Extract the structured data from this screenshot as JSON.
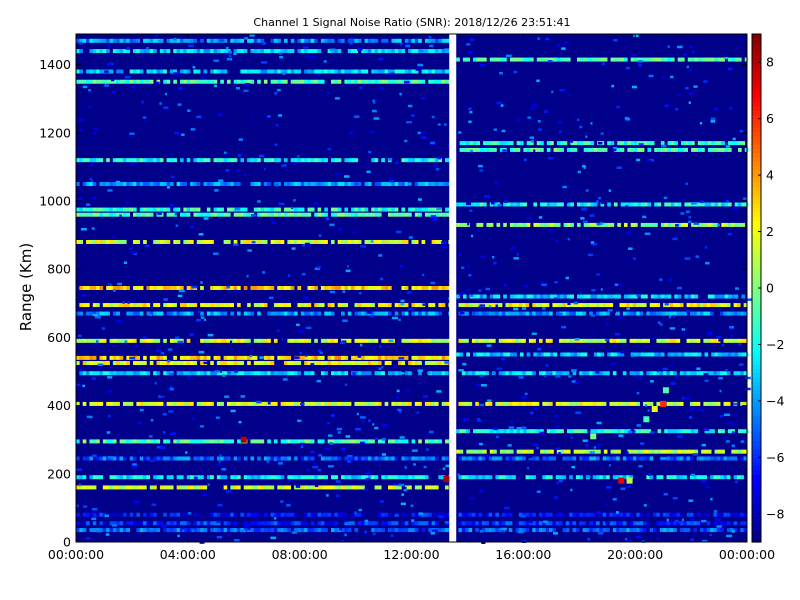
{
  "chart_data": {
    "type": "heatmap",
    "title": "Channel 1 Signal Noise Ratio (SNR): 2018/12/26 23:51:41",
    "xlabel": "",
    "ylabel": "Range (Km)",
    "x_ticks": [
      "00:00:00",
      "04:00:00",
      "08:00:00",
      "12:00:00",
      "16:00:00",
      "20:00:00",
      "00:00:00"
    ],
    "xlim_hours": [
      0,
      24
    ],
    "y_ticks": [
      0,
      200,
      400,
      600,
      800,
      1000,
      1200,
      1400
    ],
    "ylim": [
      0,
      1490
    ],
    "colorbar": {
      "min": -9,
      "max": 9,
      "ticks": [
        -8,
        -6,
        -4,
        -2,
        0,
        2,
        4,
        6,
        8
      ],
      "colormap": "jet"
    },
    "background_value": -8.8,
    "data_gap_hours": [
      13.35,
      13.6
    ],
    "range_bands": [
      {
        "range_km": 35,
        "span": "full",
        "snr": -5
      },
      {
        "range_km": 55,
        "span": "full",
        "snr": -6
      },
      {
        "range_km": 80,
        "span": "full",
        "snr": -6.5
      },
      {
        "range_km": 160,
        "span": "left",
        "snr": 1.5
      },
      {
        "range_km": 190,
        "span": "full",
        "snr": -2.5
      },
      {
        "range_km": 245,
        "span": "full",
        "snr": -5
      },
      {
        "range_km": 265,
        "span": "right",
        "snr": 1
      },
      {
        "range_km": 295,
        "span": "left",
        "snr": -1
      },
      {
        "range_km": 325,
        "span": "right",
        "snr": -2
      },
      {
        "range_km": 405,
        "span": "full",
        "snr": 1.5
      },
      {
        "range_km": 495,
        "span": "full",
        "snr": -3
      },
      {
        "range_km": 525,
        "span": "left",
        "snr": 2
      },
      {
        "range_km": 540,
        "span": "left",
        "snr": 3
      },
      {
        "range_km": 550,
        "span": "right",
        "snr": -3
      },
      {
        "range_km": 590,
        "span": "full",
        "snr": 1.5
      },
      {
        "range_km": 670,
        "span": "full",
        "snr": -4
      },
      {
        "range_km": 695,
        "span": "full",
        "snr": 2
      },
      {
        "range_km": 720,
        "span": "right",
        "snr": -3
      },
      {
        "range_km": 745,
        "span": "left",
        "snr": 3
      },
      {
        "range_km": 880,
        "span": "left",
        "snr": 1.5
      },
      {
        "range_km": 930,
        "span": "right",
        "snr": 0.5
      },
      {
        "range_km": 960,
        "span": "left",
        "snr": -1
      },
      {
        "range_km": 975,
        "span": "left",
        "snr": -1.5
      },
      {
        "range_km": 990,
        "span": "right",
        "snr": -2
      },
      {
        "range_km": 1050,
        "span": "left",
        "snr": -4
      },
      {
        "range_km": 1120,
        "span": "left",
        "snr": -2
      },
      {
        "range_km": 1150,
        "span": "right",
        "snr": -1
      },
      {
        "range_km": 1170,
        "span": "right",
        "snr": -1.5
      },
      {
        "range_km": 1350,
        "span": "left",
        "snr": -1
      },
      {
        "range_km": 1380,
        "span": "left",
        "snr": -3
      },
      {
        "range_km": 1415,
        "span": "right",
        "snr": -1
      },
      {
        "range_km": 1440,
        "span": "left",
        "snr": -3
      },
      {
        "range_km": 1470,
        "span": "left",
        "snr": -4
      }
    ],
    "hotspots": [
      {
        "time_h": 6.0,
        "range_km": 300,
        "snr": 8
      },
      {
        "time_h": 13.25,
        "range_km": 185,
        "snr": 8
      },
      {
        "time_h": 21.0,
        "range_km": 405,
        "snr": 6
      },
      {
        "time_h": 20.7,
        "range_km": 390,
        "snr": 2
      },
      {
        "time_h": 20.4,
        "range_km": 360,
        "snr": -1
      },
      {
        "time_h": 19.5,
        "range_km": 180,
        "snr": 7
      },
      {
        "time_h": 19.8,
        "range_km": 180,
        "snr": 1
      },
      {
        "time_h": 21.1,
        "range_km": 445,
        "snr": -1
      },
      {
        "time_h": 18.5,
        "range_km": 310,
        "snr": 0
      }
    ]
  }
}
